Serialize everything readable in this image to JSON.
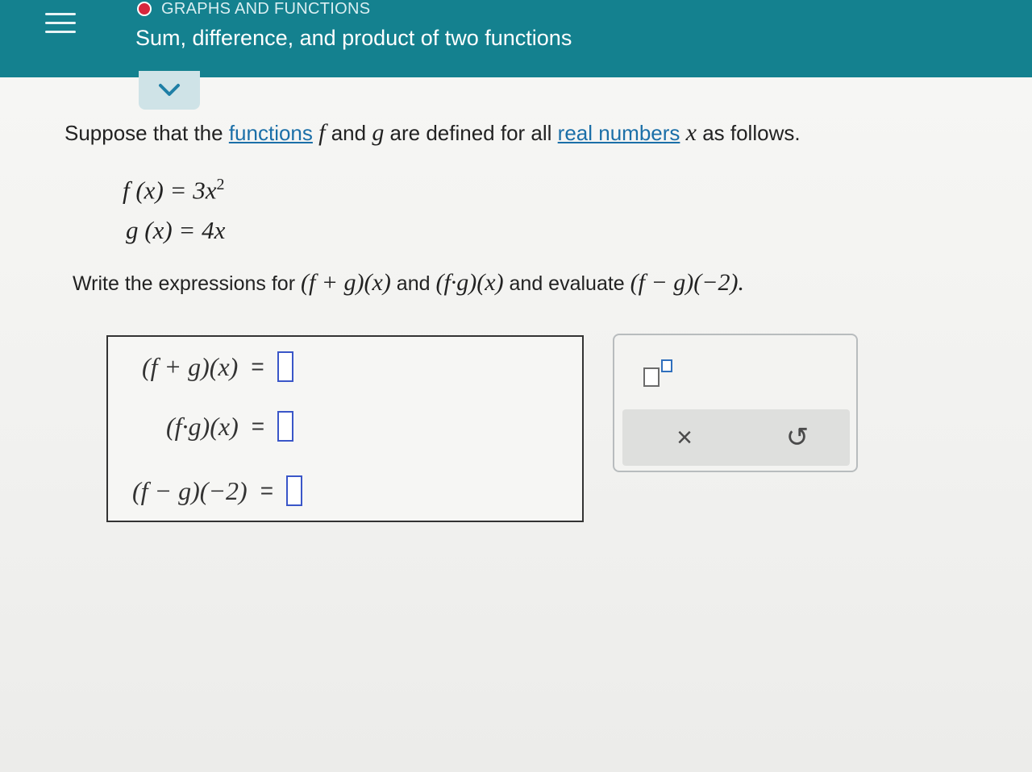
{
  "header": {
    "topic": "GRAPHS AND FUNCTIONS",
    "title": "Sum, difference, and product of two functions"
  },
  "intro": {
    "before_functions": "Suppose that the ",
    "functions_link": "functions",
    "f": "f",
    "and_g": " and ",
    "g": "g",
    "middle": " are defined for all ",
    "real_numbers_link": "real numbers",
    "x": "x",
    "end": " as follows."
  },
  "definitions": {
    "f_lhs": "f (x) = 3x",
    "f_exp": "2",
    "g_lhs": "g (x) = 4x"
  },
  "task": {
    "part1": "Write the expressions for ",
    "expr1": "(f + g)(x)",
    "part2": " and ",
    "expr2": "(f·g)(x)",
    "part3": " and evaluate ",
    "expr3": "(f − g)(−2)."
  },
  "answers": [
    {
      "label": "(f + g)(x)",
      "eq": "=",
      "value": ""
    },
    {
      "label": "(f·g)(x)",
      "eq": "=",
      "value": ""
    },
    {
      "label": "(f − g)(−2)",
      "eq": "=",
      "value": ""
    }
  ],
  "toolbar": {
    "exponent_icon": "exponent-icon",
    "clear_symbol": "×",
    "undo_symbol": "↺"
  },
  "colors": {
    "header": "#14818f",
    "link": "#1b6fa8",
    "input_border": "#3a56c8",
    "topic_dot": "#d7263d"
  }
}
